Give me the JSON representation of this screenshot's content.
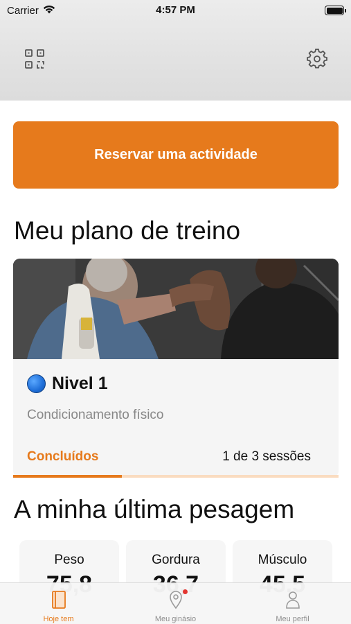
{
  "status_bar": {
    "carrier": "Carrier",
    "time": "4:57 PM"
  },
  "header": {
    "left_icon": "qr-code-icon",
    "right_icon": "gear-icon"
  },
  "reserve_button": {
    "label": "Reservar uma actividade"
  },
  "training_plan": {
    "title": "Meu plano de treino",
    "level": "Nivel 1",
    "subtitle": "Condicionamento físico",
    "status": "Concluídos",
    "sessions": "1 de 3 sessões",
    "progress": 0.333
  },
  "weighing": {
    "title": "A minha última pesagem",
    "stats": [
      {
        "label": "Peso",
        "value": "75,8"
      },
      {
        "label": "Gordura",
        "value": "36,7"
      },
      {
        "label": "Músculo",
        "value": "45,5"
      }
    ]
  },
  "tab_bar": {
    "tabs": [
      {
        "label": "Hoje tem",
        "icon": "book-icon",
        "active": true
      },
      {
        "label": "Meu ginásio",
        "icon": "location-pin-icon",
        "active": false
      },
      {
        "label": "Meu perfil",
        "icon": "person-icon",
        "active": false
      }
    ]
  },
  "colors": {
    "accent": "#e67a1c",
    "progress_track": "#fadcc0",
    "level_dot": "#1e6ed8",
    "notification": "#e3342f"
  }
}
